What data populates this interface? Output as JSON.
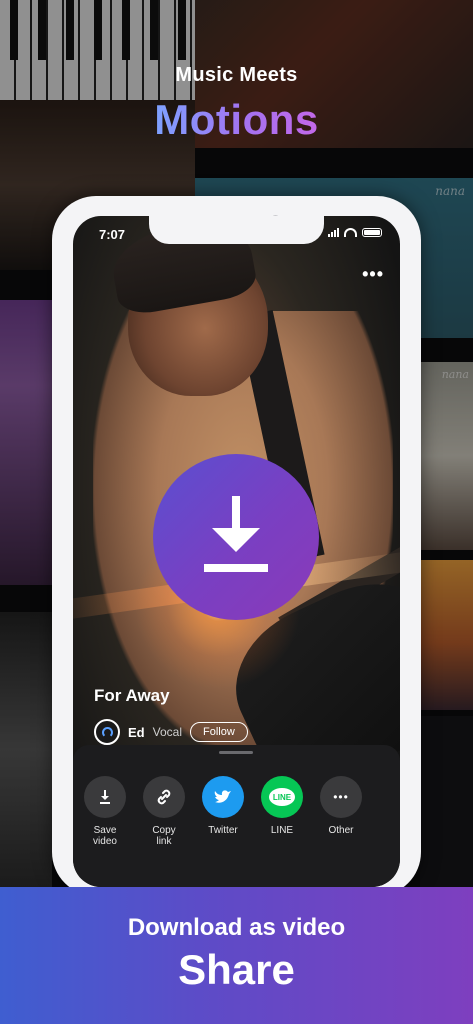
{
  "headline": {
    "small": "Music Meets",
    "big": "Motions"
  },
  "background": {
    "label1": "nana",
    "label2": "nana"
  },
  "phone": {
    "status_time": "7:07",
    "song_title": "For Away",
    "artist": {
      "name": "Ed",
      "role": "Vocal",
      "follow_label": "Follow"
    },
    "share": [
      {
        "label": "Save\nvideo",
        "icon": "download-icon"
      },
      {
        "label": "Copy\nlink",
        "icon": "link-icon"
      },
      {
        "label": "Twitter",
        "icon": "twitter-icon"
      },
      {
        "label": "LINE",
        "icon": "line-icon",
        "badge": "LINE"
      },
      {
        "label": "Other",
        "icon": "more-icon"
      }
    ]
  },
  "banner": {
    "line1": "Download as video",
    "line2": "Share"
  },
  "colors": {
    "accent_start": "#3f5ed0",
    "accent_end": "#7e3fbf",
    "twitter": "#1d9bf0",
    "line": "#06c755"
  }
}
